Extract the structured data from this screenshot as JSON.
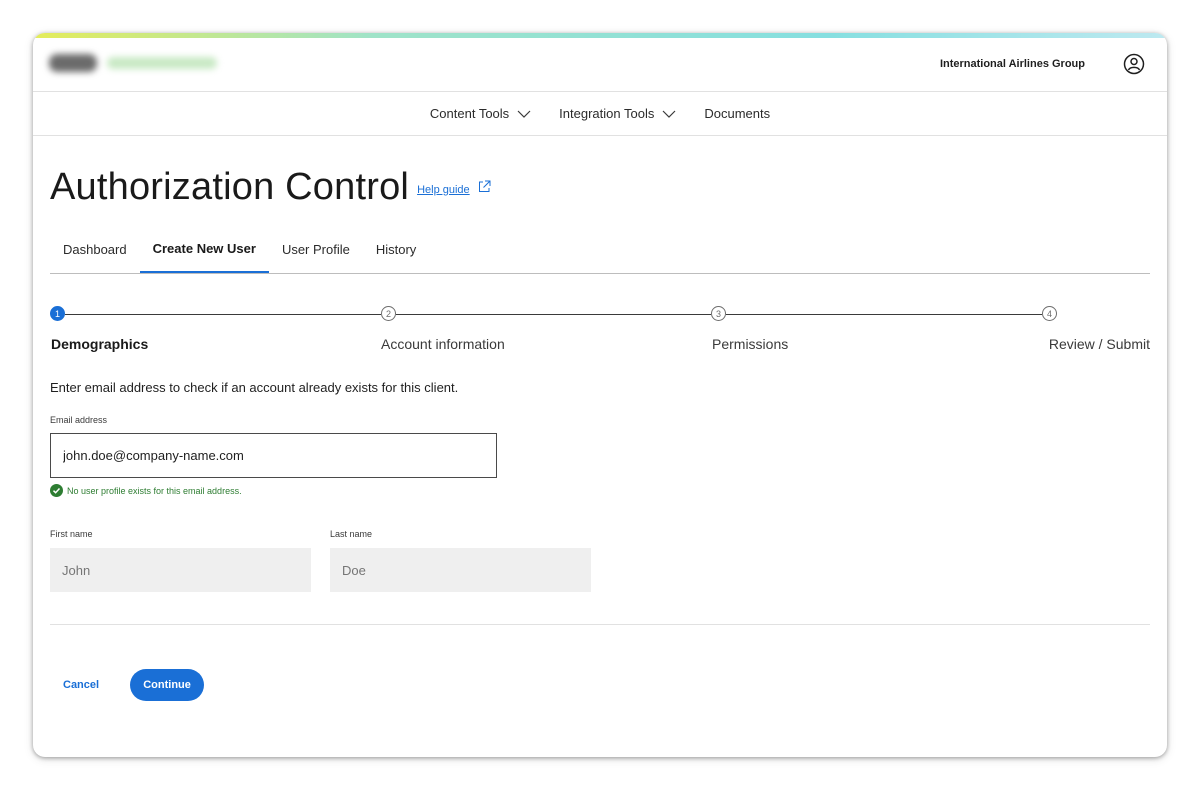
{
  "header": {
    "org_name": "International Airlines Group",
    "user_icon": "user-circle-icon"
  },
  "nav": {
    "items": [
      {
        "label": "Content Tools",
        "has_dropdown": true
      },
      {
        "label": "Integration Tools",
        "has_dropdown": true
      },
      {
        "label": "Documents",
        "has_dropdown": false
      }
    ]
  },
  "page": {
    "title": "Authorization Control",
    "help_link": "Help guide"
  },
  "tabs": [
    {
      "label": "Dashboard",
      "active": false
    },
    {
      "label": "Create New User",
      "active": true
    },
    {
      "label": "User Profile",
      "active": false
    },
    {
      "label": "History",
      "active": false
    }
  ],
  "stepper": {
    "steps": [
      {
        "number": "1",
        "label": "Demographics",
        "active": true
      },
      {
        "number": "2",
        "label": "Account information",
        "active": false
      },
      {
        "number": "3",
        "label": "Permissions",
        "active": false
      },
      {
        "number": "4",
        "label": "Review / Submit",
        "active": false
      }
    ]
  },
  "form": {
    "instruction": "Enter email address to check if an account already exists for this client.",
    "email": {
      "label": "Email address",
      "value": "john.doe@company-name.com",
      "validation": "No user profile exists for this email address."
    },
    "first_name": {
      "label": "First name",
      "placeholder": "John"
    },
    "last_name": {
      "label": "Last name",
      "placeholder": "Doe"
    }
  },
  "actions": {
    "cancel": "Cancel",
    "continue": "Continue"
  },
  "colors": {
    "accent": "#1a6fd6",
    "success": "#2e7d32",
    "disabled_field": "#efefef"
  }
}
